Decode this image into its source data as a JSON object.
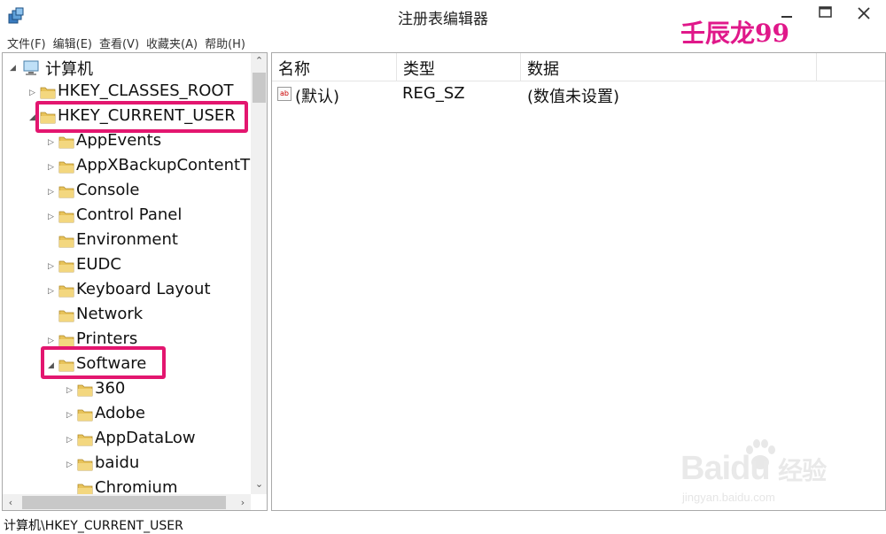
{
  "window": {
    "title": "注册表编辑器",
    "watermark": "壬辰龙99"
  },
  "menu": [
    "文件(F)",
    "编辑(E)",
    "查看(V)",
    "收藏夹(A)",
    "帮助(H)"
  ],
  "tree": {
    "root": "计算机",
    "items": [
      {
        "label": "HKEY_CLASSES_ROOT",
        "expander": "▷"
      },
      {
        "label": "HKEY_CURRENT_USER",
        "expander": "◢"
      },
      {
        "label": "AppEvents",
        "expander": "▷"
      },
      {
        "label": "AppXBackupContentT",
        "expander": "▷"
      },
      {
        "label": "Console",
        "expander": "▷"
      },
      {
        "label": "Control Panel",
        "expander": "▷"
      },
      {
        "label": "Environment",
        "expander": ""
      },
      {
        "label": "EUDC",
        "expander": "▷"
      },
      {
        "label": "Keyboard Layout",
        "expander": "▷"
      },
      {
        "label": "Network",
        "expander": ""
      },
      {
        "label": "Printers",
        "expander": "▷"
      },
      {
        "label": "Software",
        "expander": "◢"
      },
      {
        "label": "360",
        "expander": "▷"
      },
      {
        "label": "Adobe",
        "expander": "▷"
      },
      {
        "label": "AppDataLow",
        "expander": "▷"
      },
      {
        "label": "baidu",
        "expander": "▷"
      },
      {
        "label": "Chromium",
        "expander": ""
      }
    ]
  },
  "list": {
    "columns": [
      "名称",
      "类型",
      "数据"
    ],
    "rows": [
      {
        "name": "(默认)",
        "type": "REG_SZ",
        "data": "(数值未设置)"
      }
    ]
  },
  "status": "计算机\\HKEY_CURRENT_USER",
  "baidu_watermark": {
    "word": "Baidu",
    "cn": "经验",
    "sub": "jingyan.baidu.com"
  },
  "colors": {
    "highlight": "#e3166f",
    "folder": "#e8c35a",
    "watermark": "#e0188a"
  }
}
